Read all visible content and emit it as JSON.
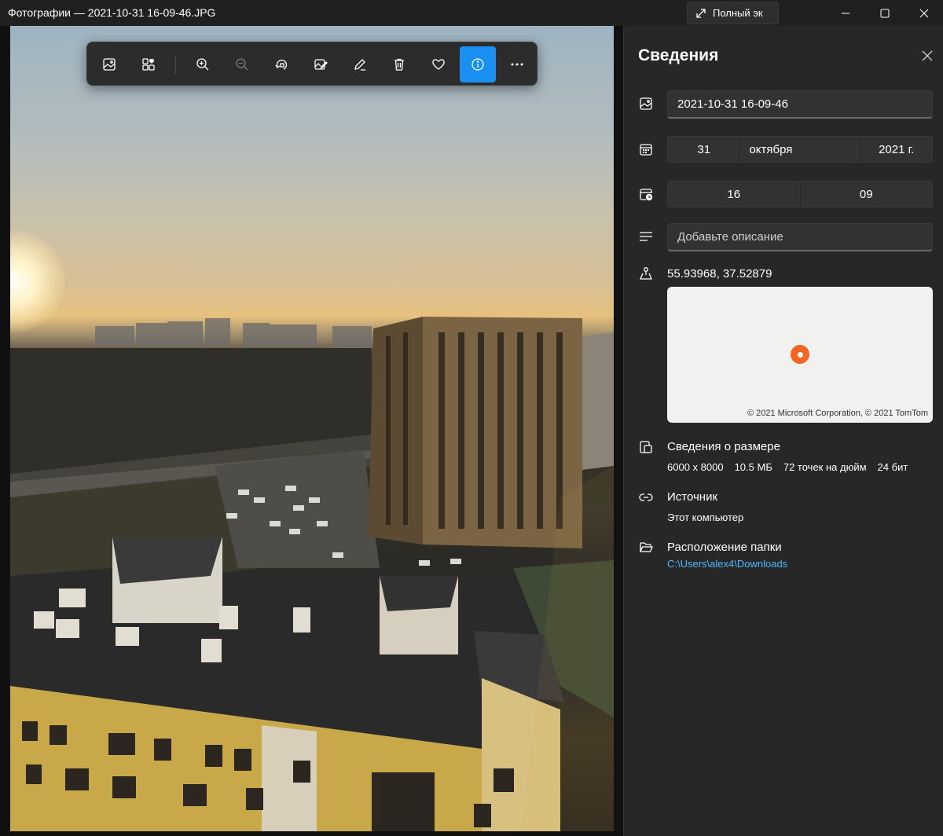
{
  "window": {
    "title": "Фотографии — 2021-10-31 16-09-46.JPG",
    "fullscreen_label": "Полный эк"
  },
  "toolbar": {
    "buttons": [
      {
        "name": "gallery-icon",
        "label": "Галерея"
      },
      {
        "name": "collection-icon",
        "label": "Коллекция"
      },
      {
        "name": "zoom-in-icon",
        "label": "Увеличить"
      },
      {
        "name": "zoom-out-icon",
        "label": "Уменьшить"
      },
      {
        "name": "rotate-icon",
        "label": "Повернуть"
      },
      {
        "name": "edit-image-icon",
        "label": "Изменить"
      },
      {
        "name": "draw-icon",
        "label": "Рисовать"
      },
      {
        "name": "delete-icon",
        "label": "Удалить"
      },
      {
        "name": "favorite-icon",
        "label": "Избранное"
      },
      {
        "name": "info-icon",
        "label": "Сведения",
        "active": true
      },
      {
        "name": "more-icon",
        "label": "Ещё"
      }
    ]
  },
  "panel": {
    "title": "Сведения",
    "file_name": "2021-10-31 16-09-46",
    "date": {
      "day": "31",
      "month": "октября",
      "year": "2021 г."
    },
    "time": {
      "hour": "16",
      "minute": "09"
    },
    "description_placeholder": "Добавьте описание",
    "coordinates": "55.93968, 37.52879",
    "map_attribution": "© 2021 Microsoft Corporation, © 2021 TomTom",
    "size": {
      "title": "Сведения о размере",
      "dimensions": "6000 x 8000",
      "file_size": "10.5 МБ",
      "dpi": "72 точек на дюйм",
      "bit_depth": "24 бит"
    },
    "source": {
      "title": "Источник",
      "value": "Этот компьютер"
    },
    "folder": {
      "title": "Расположение папки",
      "path": "C:\\Users\\alex4\\Downloads"
    }
  },
  "colors": {
    "accent": "#1a90f2",
    "link": "#4cb8ff",
    "map_pin": "#f26522",
    "panel_bg": "#272727"
  }
}
